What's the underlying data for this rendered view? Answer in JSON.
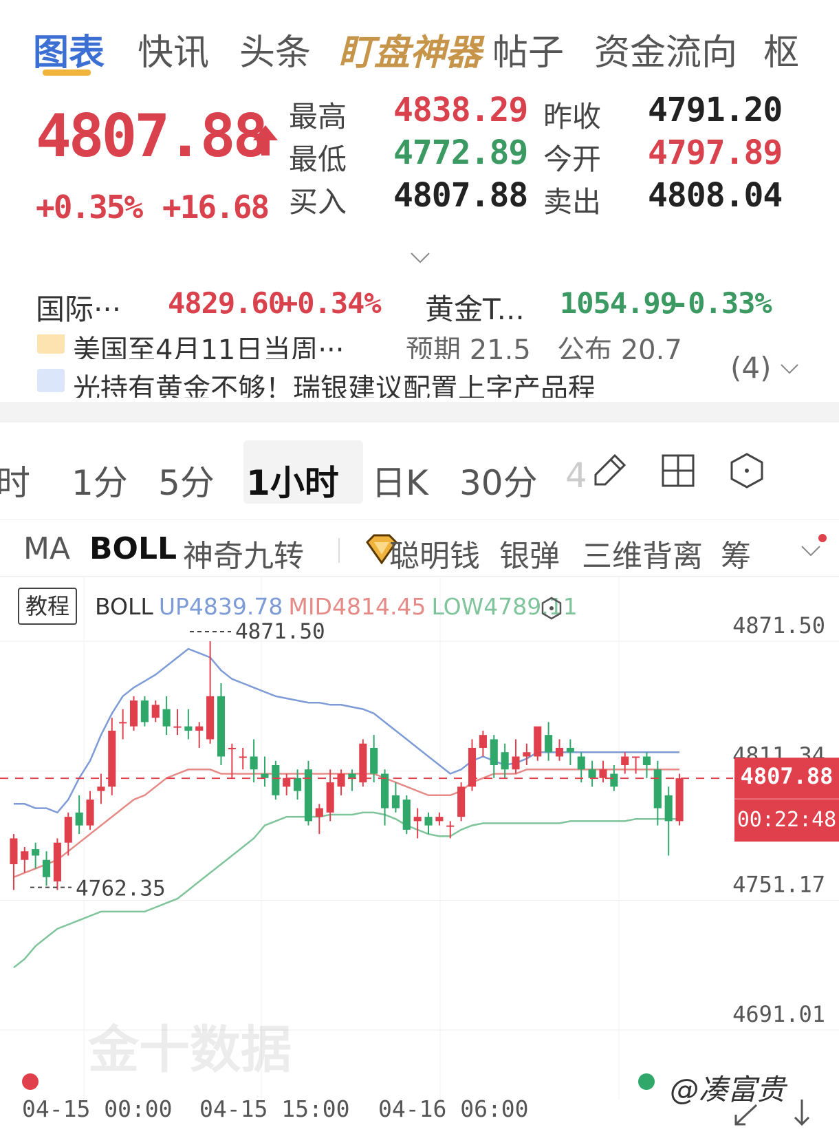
{
  "tabs": [
    {
      "label": "图表",
      "active": true
    },
    {
      "label": "快讯"
    },
    {
      "label": "头条"
    },
    {
      "label": "盯盘神器",
      "special": true
    },
    {
      "label": "帖子"
    },
    {
      "label": "资金流向"
    },
    {
      "label": "枢"
    }
  ],
  "quote": {
    "price": "4807.88",
    "change_pct": "+0.35%",
    "change_abs": "+16.68",
    "high_label": "最高",
    "high": "4838.29",
    "low_label": "最低",
    "low": "4772.89",
    "bid_label": "买入",
    "bid": "4807.88",
    "prev_close_label": "昨收",
    "prev_close": "4791.20",
    "open_label": "今开",
    "open": "4797.89",
    "ask_label": "卖出",
    "ask": "4808.04"
  },
  "related": [
    {
      "name": "国际···",
      "price": "4829.60",
      "change": "+0.34%"
    },
    {
      "name": "黄金T...",
      "price": "1054.99",
      "change": "-0.33%"
    }
  ],
  "news": {
    "line1": {
      "text": "美国至4月11日当周···",
      "forecast": "预期 21.5",
      "published": "公布 20.7"
    },
    "line2": {
      "text": "光持有黄金不够！瑞银建议配置上字产品程"
    },
    "count": "(4)"
  },
  "periods": [
    {
      "label": "时"
    },
    {
      "label": "1分"
    },
    {
      "label": "5分"
    },
    {
      "label": "1小时",
      "active": true
    },
    {
      "label": "日K"
    },
    {
      "label": "30分"
    },
    {
      "label": "4"
    }
  ],
  "indicators": [
    {
      "label": "MA"
    },
    {
      "label": "BOLL",
      "active": true
    },
    {
      "label": "神奇九转"
    },
    {
      "label": "聪明钱"
    },
    {
      "label": "银弹"
    },
    {
      "label": "三维背离"
    },
    {
      "label": "筹"
    }
  ],
  "chart_legend": {
    "tutorial": "教程",
    "name": "BOLL",
    "up": "UP4839.78",
    "mid": "MID4814.45",
    "low": "LOW4789.11"
  },
  "colors": {
    "up": "#e0404c",
    "down": "#2fa86a",
    "boll_up": "#7d9bd6",
    "boll_mid": "#e58a86",
    "boll_low": "#7fc49a"
  },
  "chart_data": {
    "type": "candlestick",
    "y_axis_labels": [
      "4871.50",
      "4811.34",
      "4751.17",
      "4691.01"
    ],
    "ylim": [
      4691.01,
      4871.5
    ],
    "x_labels": [
      "04-15 00:00",
      "04-15 15:00",
      "04-16 06:00"
    ],
    "max_marker": "4871.50",
    "min_marker": "4762.35",
    "current_price": "4807.88",
    "countdown": "00:22:48",
    "candles": [
      [
        4768,
        4780,
        4756,
        4782
      ],
      [
        4770,
        4774,
        4764,
        4776
      ],
      [
        4775,
        4772,
        4766,
        4778
      ],
      [
        4770,
        4762,
        4758,
        4774
      ],
      [
        4760,
        4778,
        4756,
        4780
      ],
      [
        4778,
        4790,
        4772,
        4792
      ],
      [
        4792,
        4786,
        4782,
        4800
      ],
      [
        4786,
        4798,
        4784,
        4802
      ],
      [
        4802,
        4804,
        4796,
        4810
      ],
      [
        4804,
        4830,
        4800,
        4836
      ],
      [
        4834,
        4834,
        4826,
        4840
      ],
      [
        4832,
        4844,
        4830,
        4846
      ],
      [
        4844,
        4834,
        4832,
        4846
      ],
      [
        4836,
        4842,
        4834,
        4844
      ],
      [
        4840,
        4832,
        4828,
        4846
      ],
      [
        4832,
        4832,
        4828,
        4840
      ],
      [
        4832,
        4830,
        4826,
        4840
      ],
      [
        4830,
        4832,
        4822,
        4834
      ],
      [
        4826,
        4846,
        4824,
        4871.5
      ],
      [
        4846,
        4818,
        4814,
        4852
      ],
      [
        4822,
        4822,
        4808,
        4824
      ],
      [
        4818,
        4818,
        4812,
        4822
      ],
      [
        4818,
        4812,
        4806,
        4826
      ],
      [
        4810,
        4808,
        4804,
        4818
      ],
      [
        4814,
        4800,
        4798,
        4816
      ],
      [
        4804,
        4808,
        4800,
        4810
      ],
      [
        4808,
        4802,
        4798,
        4812
      ],
      [
        4812,
        4788,
        4786,
        4816
      ],
      [
        4790,
        4794,
        4782,
        4796
      ],
      [
        4792,
        4806,
        4788,
        4812
      ],
      [
        4804,
        4810,
        4800,
        4812
      ],
      [
        4810,
        4808,
        4802,
        4812
      ],
      [
        4806,
        4824,
        4804,
        4826
      ],
      [
        4822,
        4810,
        4806,
        4828
      ],
      [
        4810,
        4794,
        4786,
        4812
      ],
      [
        4800,
        4794,
        4792,
        4806
      ],
      [
        4798,
        4784,
        4782,
        4800
      ],
      [
        4788,
        4790,
        4780,
        4794
      ],
      [
        4790,
        4786,
        4782,
        4792
      ],
      [
        4788,
        4790,
        4786,
        4792
      ],
      [
        4786,
        4786,
        4780,
        4788
      ],
      [
        4790,
        4804,
        4788,
        4806
      ],
      [
        4804,
        4822,
        4802,
        4826
      ],
      [
        4822,
        4828,
        4818,
        4830
      ],
      [
        4826,
        4814,
        4808,
        4828
      ],
      [
        4820,
        4812,
        4808,
        4824
      ],
      [
        4812,
        4818,
        4810,
        4826
      ],
      [
        4818,
        4820,
        4814,
        4824
      ],
      [
        4818,
        4832,
        4816,
        4830
      ],
      [
        4828,
        4820,
        4816,
        4834
      ],
      [
        4818,
        4822,
        4816,
        4826
      ],
      [
        4822,
        4820,
        4814,
        4826
      ],
      [
        4818,
        4812,
        4806,
        4820
      ],
      [
        4812,
        4808,
        4804,
        4816
      ],
      [
        4808,
        4812,
        4806,
        4816
      ],
      [
        4810,
        4804,
        4802,
        4814
      ],
      [
        4814,
        4818,
        4810,
        4820
      ],
      [
        4818,
        4818,
        4810,
        4818
      ],
      [
        4818,
        4814,
        4808,
        4820
      ],
      [
        4812,
        4794,
        4786,
        4816
      ],
      [
        4800,
        4788,
        4772,
        4804
      ],
      [
        4788,
        4807.88,
        4786,
        4810
      ]
    ],
    "boll_upper": [
      4796,
      4796,
      4794,
      4794,
      4792,
      4798,
      4808,
      4816,
      4828,
      4838,
      4846,
      4850,
      4853,
      4856,
      4860,
      4864,
      4868,
      4866,
      4864,
      4858,
      4854,
      4852,
      4850,
      4848,
      4846,
      4845,
      4844,
      4843,
      4843,
      4842,
      4842,
      4841,
      4840,
      4838,
      4834,
      4830,
      4826,
      4822,
      4818,
      4814,
      4810,
      4812,
      4816,
      4818,
      4816,
      4814,
      4815,
      4817,
      4820,
      4820,
      4820,
      4820,
      4820,
      4820,
      4820,
      4820,
      4820,
      4820,
      4820,
      4820,
      4820,
      4820
    ],
    "boll_mid": [
      4762,
      4764,
      4766,
      4768,
      4770,
      4774,
      4778,
      4782,
      4786,
      4790,
      4794,
      4798,
      4800,
      4804,
      4808,
      4810,
      4812,
      4812,
      4812,
      4810,
      4810,
      4810,
      4810,
      4810,
      4810,
      4810,
      4810,
      4810,
      4810,
      4810,
      4810,
      4810,
      4810,
      4810,
      4808,
      4806,
      4804,
      4802,
      4800,
      4800,
      4800,
      4802,
      4806,
      4808,
      4810,
      4810,
      4810,
      4812,
      4812,
      4812,
      4812,
      4812,
      4812,
      4812,
      4812,
      4812,
      4812,
      4812,
      4812,
      4812,
      4812,
      4812
    ],
    "boll_lower": [
      4720,
      4724,
      4730,
      4734,
      4738,
      4740,
      4742,
      4744,
      4746,
      4746,
      4746,
      4746,
      4746,
      4748,
      4750,
      4752,
      4756,
      4760,
      4764,
      4768,
      4772,
      4776,
      4780,
      4786,
      4788,
      4790,
      4790,
      4790,
      4790,
      4791,
      4791,
      4791,
      4792,
      4792,
      4791,
      4789,
      4786,
      4784,
      4782,
      4781,
      4781,
      4784,
      4786,
      4787,
      4787,
      4787,
      4787,
      4787,
      4787,
      4787,
      4787,
      4788,
      4788,
      4788,
      4788,
      4788,
      4788,
      4789,
      4789,
      4789,
      4789,
      4789
    ]
  },
  "watermark": "@凑富贵",
  "brand_watermark": "金十数据"
}
